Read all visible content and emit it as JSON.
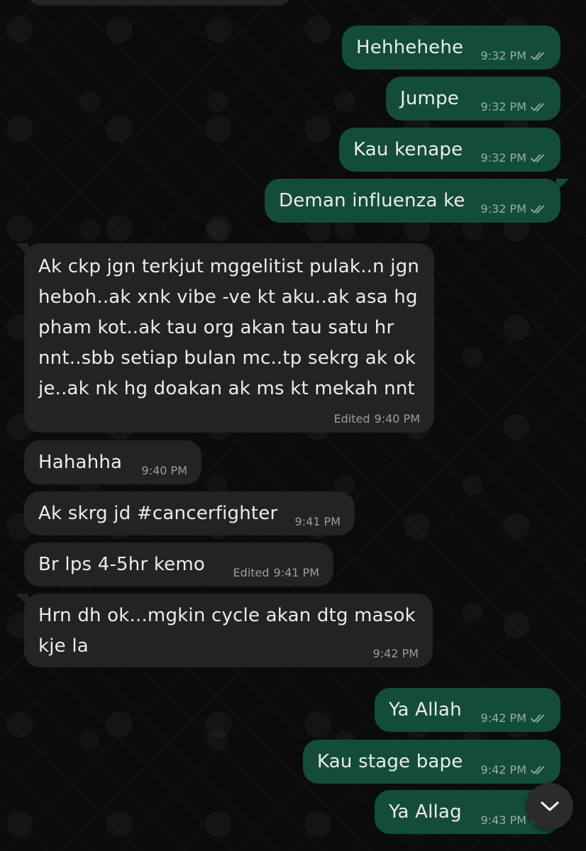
{
  "colors": {
    "outgoing_bubble": "#144d37",
    "incoming_bubble": "#232323",
    "background": "#0b0b0b",
    "text": "#ececec",
    "timestamp": "#8c8c8c"
  },
  "messages": [
    {
      "direction": "outgoing",
      "text": "Hehhehehe",
      "time": "9:32 PM",
      "edited": "",
      "read_icon": "double-check-icon"
    },
    {
      "direction": "outgoing",
      "text": "Jumpe",
      "time": "9:32 PM",
      "edited": "",
      "read_icon": "double-check-icon"
    },
    {
      "direction": "outgoing",
      "text": "Kau kenape",
      "time": "9:32 PM",
      "edited": "",
      "read_icon": "double-check-icon"
    },
    {
      "direction": "outgoing",
      "text": "Deman influenza ke",
      "time": "9:32 PM",
      "edited": "",
      "read_icon": "double-check-icon"
    },
    {
      "direction": "incoming",
      "text": "Ak ckp jgn terkjut mggelitist pulak..n jgn\nheboh..ak xnk vibe -ve kt aku..ak asa hg\npham kot..ak tau org akan tau satu hr\nnnt..sbb setiap bulan mc..tp sekrg ak ok\nje..ak nk hg doakan ak ms kt mekah nnt",
      "time": "9:40 PM",
      "edited": "Edited"
    },
    {
      "direction": "incoming",
      "text": "Hahahha",
      "time": "9:40 PM",
      "edited": ""
    },
    {
      "direction": "incoming",
      "text": "Ak skrg jd #cancerfighter",
      "time": "9:41 PM",
      "edited": ""
    },
    {
      "direction": "incoming",
      "text": "Br lps 4-5hr kemo",
      "time": "9:41 PM",
      "edited": "Edited"
    },
    {
      "direction": "incoming",
      "text": "Hrn dh ok...mgkin cycle akan dtg masok\nkje la",
      "time": "9:42 PM",
      "edited": ""
    },
    {
      "direction": "outgoing",
      "text": "Ya Allah",
      "time": "9:42 PM",
      "edited": "",
      "read_icon": "double-check-icon"
    },
    {
      "direction": "outgoing",
      "text": "Kau stage bape",
      "time": "9:42 PM",
      "edited": "",
      "read_icon": "double-check-icon"
    },
    {
      "direction": "outgoing",
      "text": "Ya Allag",
      "time": "9:43 PM",
      "edited": "",
      "read_icon": "double-check-icon"
    }
  ],
  "scroll_button": {
    "icon": "chevron-down-icon"
  }
}
